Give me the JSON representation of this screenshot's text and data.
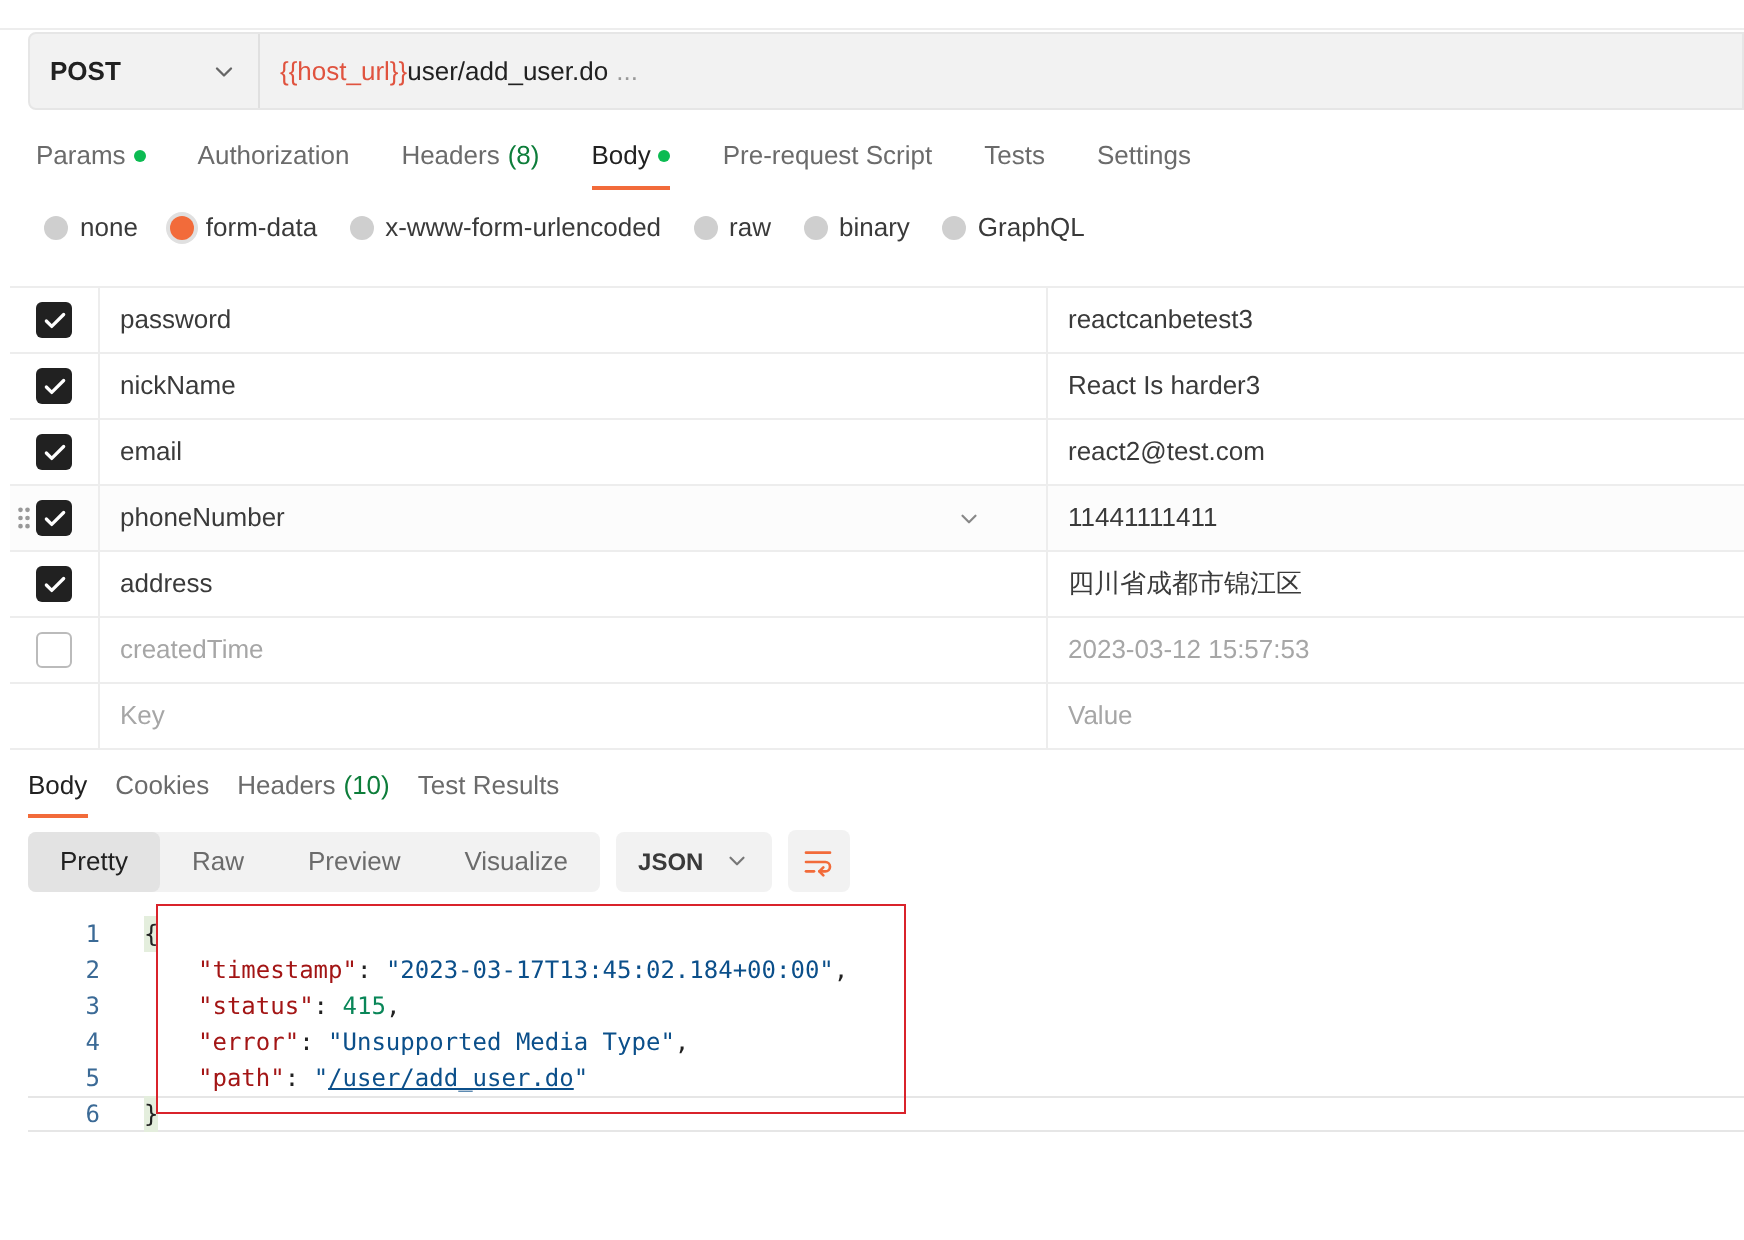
{
  "request": {
    "method": "POST",
    "url_variable": "{{host_url}}",
    "url_path": "user/add_user.do",
    "url_more": "..."
  },
  "request_tabs": [
    {
      "label": "Params",
      "dot": true,
      "selected": false
    },
    {
      "label": "Authorization",
      "dot": false,
      "selected": false
    },
    {
      "label": "Headers",
      "count": "(8)",
      "dot": false,
      "selected": false
    },
    {
      "label": "Body",
      "dot": true,
      "selected": true
    },
    {
      "label": "Pre-request Script",
      "dot": false,
      "selected": false
    },
    {
      "label": "Tests",
      "dot": false,
      "selected": false
    },
    {
      "label": "Settings",
      "dot": false,
      "selected": false
    }
  ],
  "body_types": [
    {
      "label": "none",
      "selected": false
    },
    {
      "label": "form-data",
      "selected": true
    },
    {
      "label": "x-www-form-urlencoded",
      "selected": false
    },
    {
      "label": "raw",
      "selected": false
    },
    {
      "label": "binary",
      "selected": false
    },
    {
      "label": "GraphQL",
      "selected": false
    }
  ],
  "form_rows": [
    {
      "key": "password",
      "value": "reactcanbetest3",
      "checked": true,
      "hovered": false
    },
    {
      "key": "nickName",
      "value": "React Is harder3",
      "checked": true,
      "hovered": false
    },
    {
      "key": "email",
      "value": "react2@test.com",
      "checked": true,
      "hovered": false
    },
    {
      "key": "phoneNumber",
      "value": "11441111411",
      "checked": true,
      "hovered": true
    },
    {
      "key": "address",
      "value": "四川省成都市锦江区",
      "checked": true,
      "hovered": false
    },
    {
      "key": "createdTime",
      "value": "2023-03-12 15:57:53",
      "checked": false,
      "hovered": false
    }
  ],
  "new_row": {
    "key_placeholder": "Key",
    "value_placeholder": "Value"
  },
  "response_tabs": [
    {
      "label": "Body",
      "selected": true
    },
    {
      "label": "Cookies",
      "selected": false
    },
    {
      "label": "Headers",
      "count": "(10)",
      "selected": false
    },
    {
      "label": "Test Results",
      "selected": false
    }
  ],
  "view_modes": [
    {
      "label": "Pretty",
      "selected": true
    },
    {
      "label": "Raw",
      "selected": false
    },
    {
      "label": "Preview",
      "selected": false
    },
    {
      "label": "Visualize",
      "selected": false
    }
  ],
  "format": "JSON",
  "code_lines": [
    {
      "number": "1",
      "tokens": [
        {
          "kind": "punct",
          "text": "{"
        }
      ]
    },
    {
      "number": "2",
      "tokens": [
        {
          "kind": "key",
          "text": "\"timestamp\""
        },
        {
          "kind": "punct",
          "text": ": "
        },
        {
          "kind": "string",
          "text": "\"2023-03-17T13:45:02.184+00:00\""
        },
        {
          "kind": "punct",
          "text": ","
        }
      ]
    },
    {
      "number": "3",
      "tokens": [
        {
          "kind": "key",
          "text": "\"status\""
        },
        {
          "kind": "punct",
          "text": ": "
        },
        {
          "kind": "number",
          "text": "415"
        },
        {
          "kind": "punct",
          "text": ","
        }
      ]
    },
    {
      "number": "4",
      "tokens": [
        {
          "kind": "key",
          "text": "\"error\""
        },
        {
          "kind": "punct",
          "text": ": "
        },
        {
          "kind": "string",
          "text": "\"Unsupported Media Type\""
        },
        {
          "kind": "punct",
          "text": ","
        }
      ]
    },
    {
      "number": "5",
      "tokens": [
        {
          "kind": "key",
          "text": "\"path\""
        },
        {
          "kind": "punct",
          "text": ": "
        },
        {
          "kind": "string",
          "text": "\""
        },
        {
          "kind": "link",
          "text": "/user/add_user.do"
        },
        {
          "kind": "string",
          "text": "\""
        }
      ]
    },
    {
      "number": "6",
      "tokens": [
        {
          "kind": "punct",
          "text": "}"
        }
      ]
    }
  ]
}
